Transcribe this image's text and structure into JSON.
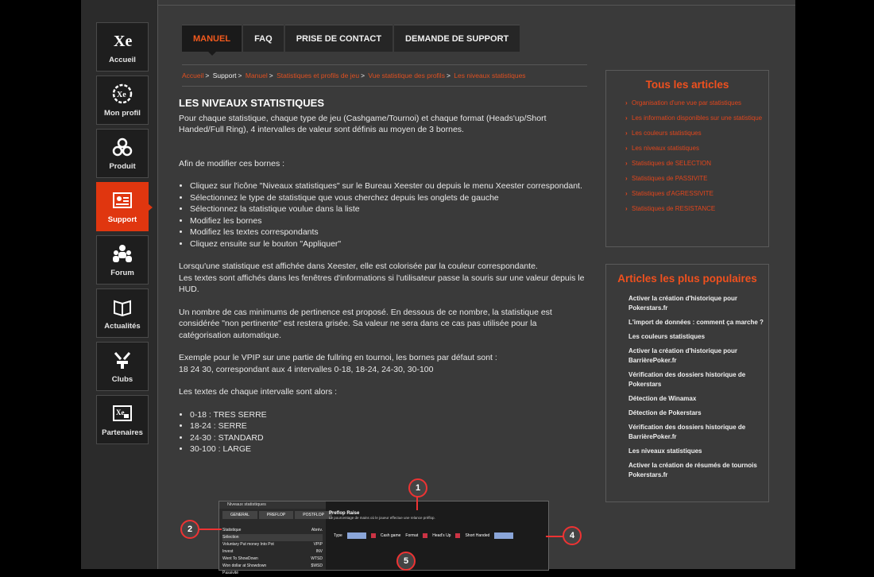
{
  "sidebar": {
    "items": [
      {
        "label": "Accueil",
        "icon": "xeester-logo-icon",
        "active": false
      },
      {
        "label": "Mon profil",
        "icon": "profile-chip-icon",
        "active": false
      },
      {
        "label": "Produit",
        "icon": "gears-icon",
        "active": false
      },
      {
        "label": "Support",
        "icon": "support-card-icon",
        "active": true
      },
      {
        "label": "Forum",
        "icon": "people-icon",
        "active": false
      },
      {
        "label": "Actualités",
        "icon": "book-icon",
        "active": false
      },
      {
        "label": "Clubs",
        "icon": "club-icon",
        "active": false
      },
      {
        "label": "Partenaires",
        "icon": "partners-icon",
        "active": false
      }
    ]
  },
  "tabs": [
    {
      "label": "MANUEL",
      "active": true
    },
    {
      "label": "FAQ",
      "active": false
    },
    {
      "label": "PRISE DE CONTACT",
      "active": false
    },
    {
      "label": "DEMANDE DE SUPPORT",
      "active": false
    }
  ],
  "breadcrumb": {
    "home": "Accueil",
    "support": "Support",
    "manuel": "Manuel",
    "stats": "Statistiques et profils de jeu",
    "vue": "Vue statistique des profils",
    "current": "Les niveaux statistiques"
  },
  "article": {
    "title": "LES NIVEAUX STATISTIQUES",
    "intro": "Pour chaque statistique, chaque type de jeu (Cashgame/Tournoi) et chaque format (Heads'up/Short Handed/Full Ring), 4 intervalles de valeur sont définis au moyen de 3 bornes.",
    "steps_intro": "Afin de modifier ces bornes :",
    "steps": [
      "Cliquez sur l'icône \"Niveaux statistiques\" sur le Bureau Xeester ou depuis le menu Xeester correspondant.",
      "Sélectionnez le type de statistique que vous cherchez depuis les onglets de gauche",
      "Sélectionnez la statistique voulue dans la liste",
      "Modifiez les bornes",
      "Modifiez les textes correspondants",
      "Cliquez ensuite sur le bouton \"Appliquer\""
    ],
    "para1": "Lorsqu'une statistique est affichée dans Xeester, elle est colorisée par la couleur correspondante.",
    "para2": "Les textes sont affichés dans les fenêtres d'informations si l'utilisateur passe la souris sur une valeur depuis le HUD.",
    "para3": "Un nombre de cas minimums de pertinence est proposé. En dessous de ce nombre, la statistique est considérée \"non pertinente\" est restera grisée. Sa valeur ne sera dans ce cas pas utilisée pour la catégorisation automatique.",
    "example1": "Exemple pour le VPIP sur une partie de fullring en tournoi, les bornes par défaut sont :",
    "example2": "18 24 30, correspondant aux 4 intervalles 0-18, 18-24, 24-30, 30-100",
    "levels_intro": "Les textes de chaque intervalle sont alors :",
    "levels": [
      "0-18 : TRES SERRE",
      "18-24 : SERRE",
      "24-30 : STANDARD",
      "30-100 : LARGE"
    ]
  },
  "all_articles": {
    "title": "Tous les articles",
    "items": [
      "Organisation d'une vue par statistiques",
      "Les information disponibles sur une statistique",
      "Les couleurs statistiques",
      "Les niveaux statistiques",
      "Statistiques de SELECTION",
      "Statistiques de PASSIVITE",
      "Statistiques d'AGRESSIVITE",
      "Statistiques de RESISTANCE"
    ]
  },
  "popular": {
    "title": "Articles les plus populaires",
    "items": [
      "Activer la création d'historique pour Pokerstars.fr",
      "L'import de données : comment ça marche ?",
      "Les couleurs statistiques",
      "Activer la création d'historique pour BarrièrePoker.fr",
      "Vérification des dossiers historique de Pokerstars",
      "Détection de Winamax",
      "Détection de Pokerstars",
      "Vérification des dossiers historique de BarrièrePoker.fr",
      "Les niveaux statistiques",
      "Activer la création de résumés de tournois Pokerstars.fr"
    ]
  },
  "screenshot": {
    "window_title": "Niveaux statistiques",
    "tabs": [
      "GENERAL",
      "PREFLOP",
      "POSTFLOP"
    ],
    "subheader_left": "Statistique",
    "subheader_right": "Abrév.",
    "rows": [
      {
        "name": "Sélection",
        "abbr": ""
      },
      {
        "name": "Voluntary Put money Into Pot",
        "abbr": "VPIP"
      },
      {
        "name": "Invest",
        "abbr": "INV"
      },
      {
        "name": "Went To ShowDown",
        "abbr": "WTSD"
      },
      {
        "name": "Won dollar at Showdown",
        "abbr": "$WSD"
      },
      {
        "name": "Passivité",
        "abbr": ""
      }
    ],
    "stat_title": "Preflop Raise",
    "stat_desc": "Le pourcentage de mains où le joueur effectue une relance préflop.",
    "type_label": "Type",
    "cash_label": "Cash game",
    "format_label": "Format",
    "hu_label": "Head's Up",
    "sh_label": "Short Handed",
    "callouts": [
      "1",
      "2",
      "4",
      "5"
    ]
  }
}
